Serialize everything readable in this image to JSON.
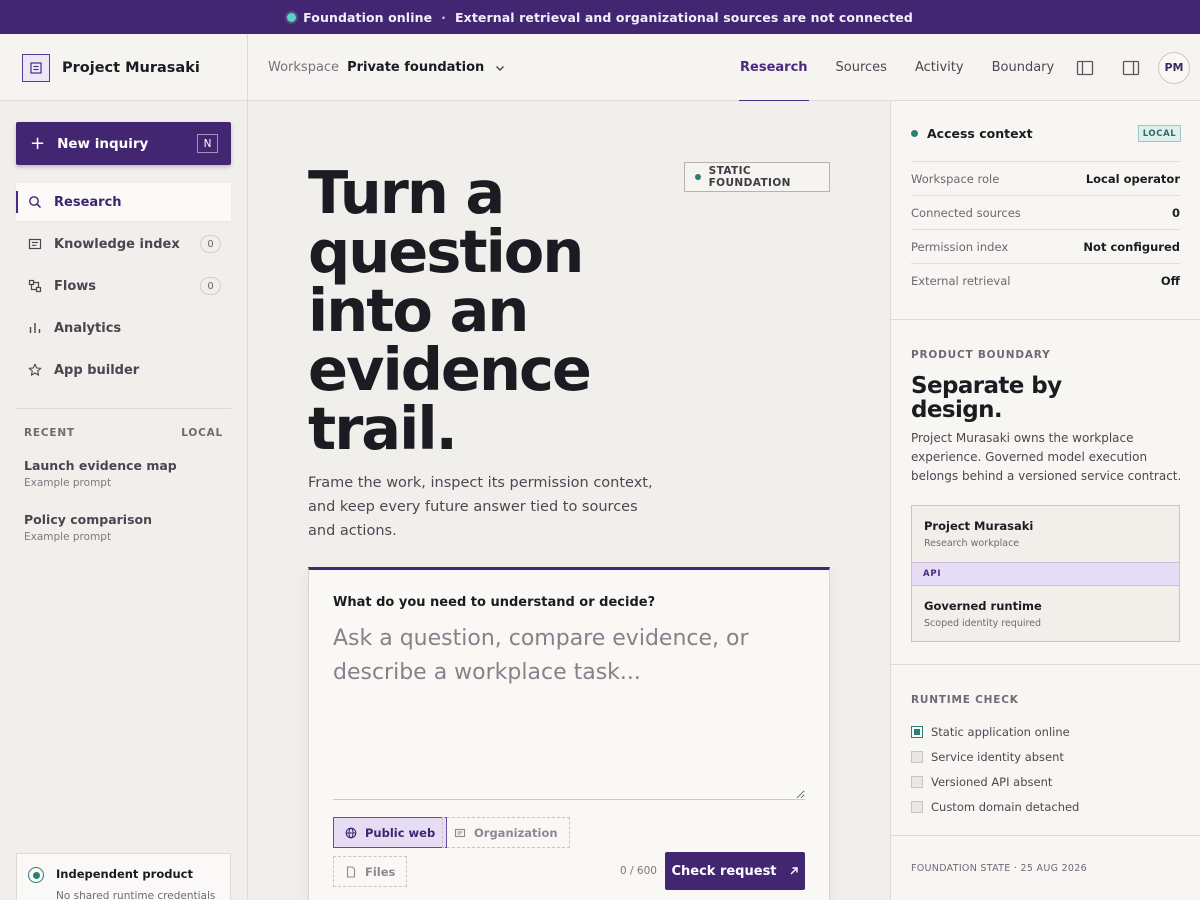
{
  "banner": {
    "status": "Foundation online",
    "separator": "·",
    "message": "External retrieval and organizational sources are not connected"
  },
  "header": {
    "brand": "Project Murasaki",
    "workspace_label": "Workspace",
    "workspace_value": "Private foundation",
    "tabs": [
      {
        "label": "Research",
        "active": true
      },
      {
        "label": "Sources",
        "active": false
      },
      {
        "label": "Activity",
        "active": false
      },
      {
        "label": "Boundary",
        "active": false
      }
    ],
    "avatar_initials": "PM",
    "icons": [
      "sidebar-left-icon",
      "sidebar-right-icon"
    ]
  },
  "sidebar": {
    "new_button": {
      "label": "New inquiry",
      "shortcut": "N"
    },
    "items": [
      {
        "label": "Research",
        "icon": "search-icon",
        "count": null,
        "active": true
      },
      {
        "label": "Knowledge index",
        "icon": "document-icon",
        "count": "0",
        "active": false
      },
      {
        "label": "Flows",
        "icon": "flow-icon",
        "count": "0",
        "active": false
      },
      {
        "label": "Analytics",
        "icon": "bar-chart-icon",
        "count": null,
        "active": false
      },
      {
        "label": "App builder",
        "icon": "star-icon",
        "count": null,
        "active": false
      }
    ],
    "recent_label": "RECENT",
    "recent_scope": "LOCAL",
    "recent": [
      {
        "title": "Launch evidence map",
        "subtitle": "Example prompt"
      },
      {
        "title": "Policy comparison",
        "subtitle": "Example prompt"
      }
    ],
    "independent": {
      "title": "Independent product",
      "subtitle": "No shared runtime credentials"
    }
  },
  "main": {
    "badge": "STATIC FOUNDATION",
    "hero_lines": [
      "Turn a",
      "question",
      "into an",
      "evidence",
      "trail."
    ],
    "lede": "Frame the work, inspect its permission context, and keep every future answer tied to sources and actions.",
    "composer": {
      "question": "What do you need to understand or decide?",
      "placeholder": "Ask a question, compare evidence, or describe a workplace task...",
      "chips": [
        {
          "label": "Public web",
          "icon": "globe-icon",
          "selected": true
        },
        {
          "label": "Organization",
          "icon": "building-icon",
          "selected": false
        },
        {
          "label": "Files",
          "icon": "file-icon",
          "selected": false
        }
      ],
      "counter": "0 / 600",
      "submit_label": "Check request"
    }
  },
  "right": {
    "access": {
      "title": "Access context",
      "badge": "LOCAL",
      "rows": [
        {
          "key": "Workspace role",
          "value": "Local operator"
        },
        {
          "key": "Connected sources",
          "value": "0"
        },
        {
          "key": "Permission index",
          "value": "Not configured"
        },
        {
          "key": "External retrieval",
          "value": "Off"
        }
      ]
    },
    "boundary": {
      "eyebrow": "PRODUCT BOUNDARY",
      "title": "Separate by design.",
      "body": "Project Murasaki owns the workplace experience. Governed model execution belongs behind a versioned service contract.",
      "top": {
        "title": "Project Murasaki",
        "subtitle": "Research workplace"
      },
      "api": "API",
      "bottom": {
        "title": "Governed runtime",
        "subtitle": "Scoped identity required"
      }
    },
    "runtime": {
      "eyebrow": "RUNTIME CHECK",
      "checks": [
        {
          "label": "Static application online",
          "checked": true
        },
        {
          "label": "Service identity absent",
          "checked": false
        },
        {
          "label": "Versioned API absent",
          "checked": false
        },
        {
          "label": "Custom domain detached",
          "checked": false
        }
      ]
    },
    "footer": "FOUNDATION STATE · 25 AUG 2026"
  },
  "colors": {
    "brand": "#432672",
    "accent_teal": "#2c7d73",
    "background": "#f1efeb"
  }
}
